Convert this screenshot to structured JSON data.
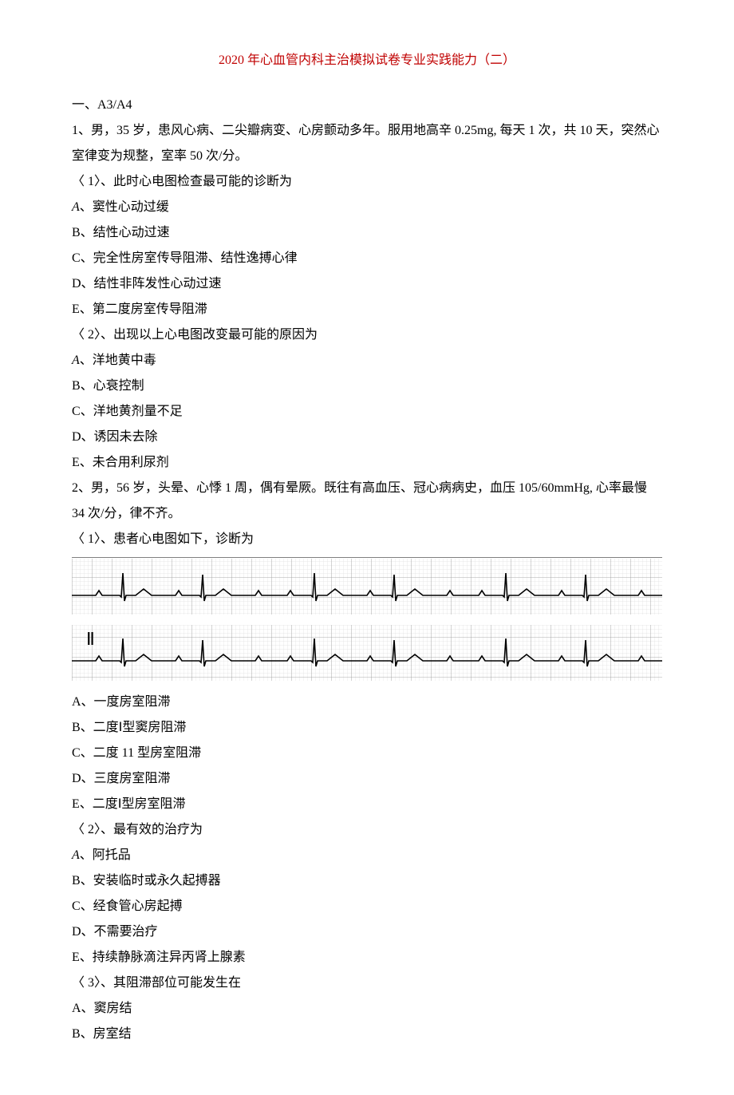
{
  "title": "2020 年心血管内科主治模拟试卷专业实践能力（二）",
  "section1": "一、A3/A4",
  "q1_stem": "1、男，35 岁，患风心病、二尖瓣病变、心房颤动多年。服用地高辛 0.25mg, 每天 1 次，共 10 天，突然心室律变为规整，室率 50 次/分。",
  "q1_1_prompt": "〈 1〉、此时心电图检查最可能的诊断为",
  "q1_1_A_prefix": "A",
  "q1_1_A": "、窦性心动过缓",
  "q1_1_B": "B、结性心动过速",
  "q1_1_C": "C、完全性房室传导阻滞、结性逸搏心律",
  "q1_1_D": "D、结性非阵发性心动过速",
  "q1_1_E": "E、第二度房室传导阻滞",
  "q1_2_prompt": "〈 2〉、出现以上心电图改变最可能的原因为",
  "q1_2_A_prefix": "A",
  "q1_2_A": "、洋地黄中毒",
  "q1_2_B": "B、心衰控制",
  "q1_2_C": "C、洋地黄剂量不足",
  "q1_2_D": "D、诱因未去除",
  "q1_2_E": "E、未合用利尿剂",
  "q2_stem": "2、男，56 岁，头晕、心悸 1 周，偶有晕厥。既往有高血压、冠心病病史，血压 105/60mmHg, 心率最慢 34 次/分，律不齐。",
  "q2_1_prompt": "〈 1〉、患者心电图如下，诊断为",
  "ecg_lead_label": "Ⅱ",
  "q2_1_A": "A、一度房室阻滞",
  "q2_1_B": "B、二度Ⅰ型窦房阻滞",
  "q2_1_C": "C、二度 11 型房室阻滞",
  "q2_1_D": "D、三度房室阻滞",
  "q2_1_E": "E、二度Ⅰ型房室阻滞",
  "q2_2_prompt": "〈 2〉、最有效的治疗为",
  "q2_2_A_prefix": "A",
  "q2_2_A": "、阿托品",
  "q2_2_B": "B、安装临时或永久起搏器",
  "q2_2_C": "C、经食管心房起搏",
  "q2_2_D": "D、不需要治疗",
  "q2_2_E": "E、持续静脉滴注异丙肾上腺素",
  "q2_3_prompt": "〈 3〉、其阻滞部位可能发生在",
  "q2_3_A": "A、窦房结",
  "q2_3_B": "B、房室结"
}
